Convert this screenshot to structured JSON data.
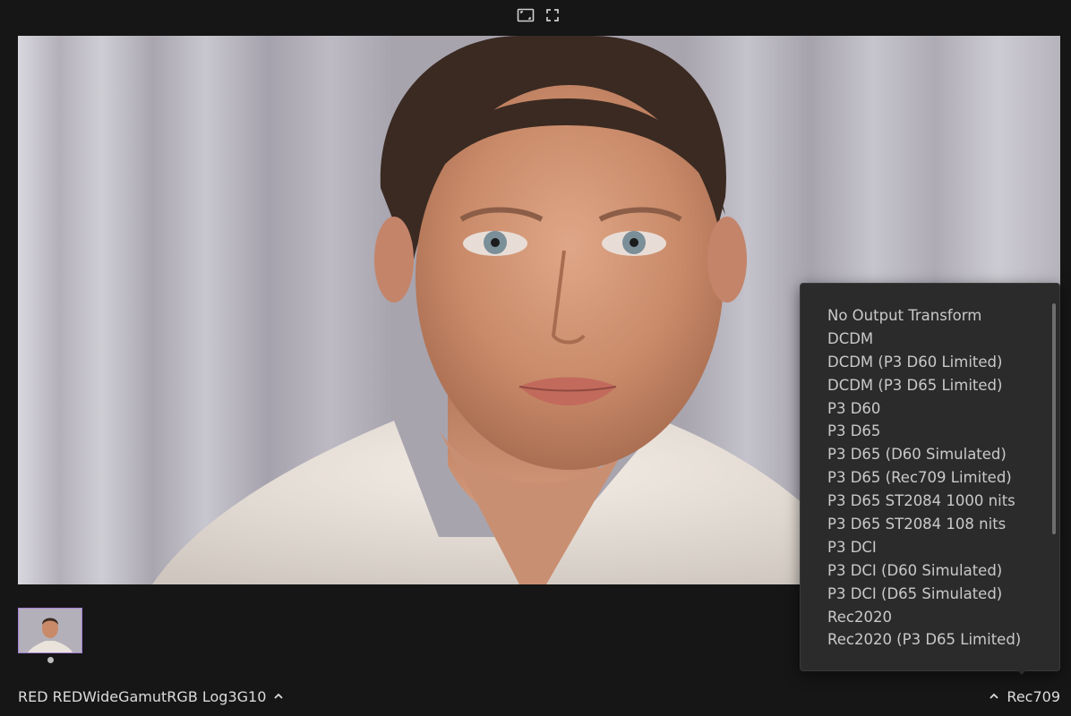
{
  "toolbar": {
    "fit_icon": "fit-to-window-icon",
    "fullscreen_icon": "fullscreen-icon"
  },
  "input_transform": {
    "label": "RED REDWideGamutRGB Log3G10",
    "icon": "chevron-up-icon"
  },
  "output_transform": {
    "label": "Rec709",
    "icon": "chevron-up-icon",
    "options": [
      "No Output Transform",
      "DCDM",
      "DCDM (P3 D60 Limited)",
      "DCDM (P3 D65 Limited)",
      "P3 D60",
      "P3 D65",
      "P3 D65 (D60 Simulated)",
      "P3 D65 (Rec709 Limited)",
      "P3 D65 ST2084 1000 nits",
      "P3 D65 ST2084 108 nits",
      "P3 DCI",
      "P3 DCI (D60 Simulated)",
      "P3 DCI (D65 Simulated)",
      "Rec2020",
      "Rec2020 (P3 D65 Limited)"
    ]
  },
  "colors": {
    "background": "#161616",
    "dropdown_bg": "#2b2b2b",
    "thumb_border": "#a47ed6"
  }
}
